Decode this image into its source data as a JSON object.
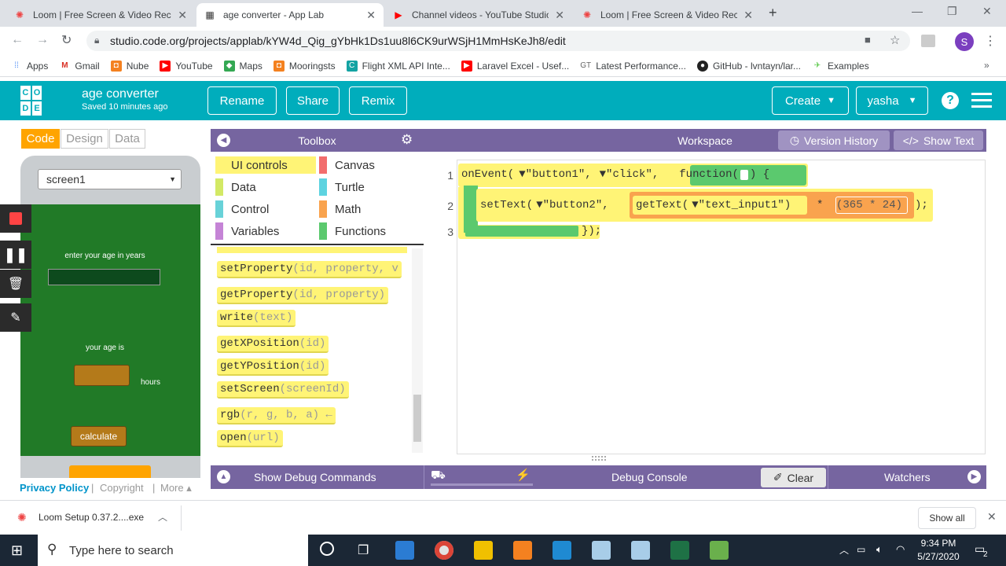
{
  "browser": {
    "tabs": [
      {
        "title": "Loom | Free Screen & Video Rec",
        "icon": "loom-icon"
      },
      {
        "title": "age converter - App Lab",
        "icon": "applab-icon"
      },
      {
        "title": "Channel videos - YouTube Studio",
        "icon": "youtube-icon"
      },
      {
        "title": "Loom | Free Screen & Video Rec",
        "icon": "loom-icon"
      }
    ],
    "url": "studio.code.org/projects/applab/kYW4d_Qig_gYbHk1Ds1uu8l6CK9urWSjH1MmHsKeJh8/edit",
    "profile_initial": "S",
    "bookmarks": [
      "Apps",
      "Gmail",
      "Nube",
      "YouTube",
      "Maps",
      "Mooringsts",
      "Flight XML API Inte...",
      "Laravel Excel - Usef...",
      "Latest Performance...",
      "GitHub - lvntayn/lar...",
      "Examples"
    ]
  },
  "header": {
    "logo": [
      "C",
      "O",
      "D",
      "E"
    ],
    "project_name": "age converter",
    "saved": "Saved 10 minutes ago",
    "rename": "Rename",
    "share": "Share",
    "remix": "Remix",
    "create": "Create",
    "user": "yasha",
    "help": "?"
  },
  "left": {
    "tabs": [
      "Code",
      "Design",
      "Data"
    ],
    "screen": "screen1",
    "app": {
      "label1": "enter your age in years",
      "label2": "your age is",
      "hours": "hours",
      "calculate": "calculate"
    },
    "footer": {
      "privacy": "Privacy Policy",
      "copyright": "Copyright",
      "more": "More"
    }
  },
  "toolbox": {
    "title": "Toolbox",
    "categories": [
      {
        "label": "UI controls",
        "color": "#fff476"
      },
      {
        "label": "Canvas",
        "color": "#f26d6d"
      },
      {
        "label": "Data",
        "color": "#d3e965"
      },
      {
        "label": "Turtle",
        "color": "#5dd3e0"
      },
      {
        "label": "Control",
        "color": "#68d2d8"
      },
      {
        "label": "Math",
        "color": "#f9a34e"
      },
      {
        "label": "Variables",
        "color": "#c584d6"
      },
      {
        "label": "Functions",
        "color": "#5bc96e"
      }
    ],
    "blocks": [
      {
        "name": "setProperty",
        "params": "(id, property, v"
      },
      {
        "name": "getProperty",
        "params": "(id, property)"
      },
      {
        "name": "write",
        "params": "(text)"
      },
      {
        "name": "getXPosition",
        "params": "(id)"
      },
      {
        "name": "getYPosition",
        "params": "(id)"
      },
      {
        "name": "setScreen",
        "params": "(screenId)"
      },
      {
        "name": "rgb",
        "params": "(r, g, b, a) ←"
      },
      {
        "name": "open",
        "params": "(url)"
      }
    ]
  },
  "workspace": {
    "title": "Workspace",
    "version_history": "Version History",
    "show_text": "Show Text",
    "lines": [
      "1",
      "2",
      "3"
    ],
    "code": {
      "onEvent": "onEvent(",
      "arg1": "▼\"button1\",",
      "arg2": "▼\"click\",",
      "function": "function(",
      "brace": ") {",
      "setText": "setText(",
      "arg3": "▼\"button2\",",
      "getText": "getText(",
      "arg4": "▼\"text_input1\")",
      "mul": "*",
      "expr": "(365 * 24)",
      "end2": ");",
      "close": "});"
    }
  },
  "debug": {
    "show": "Show Debug Commands",
    "console": "Debug Console",
    "clear": "Clear",
    "watchers": "Watchers"
  },
  "downloads": {
    "file": "Loom Setup 0.37.2....exe",
    "show_all": "Show all"
  },
  "taskbar": {
    "search": "Type here to search",
    "time": "9:34 PM",
    "date": "5/27/2020",
    "notif": "2"
  }
}
